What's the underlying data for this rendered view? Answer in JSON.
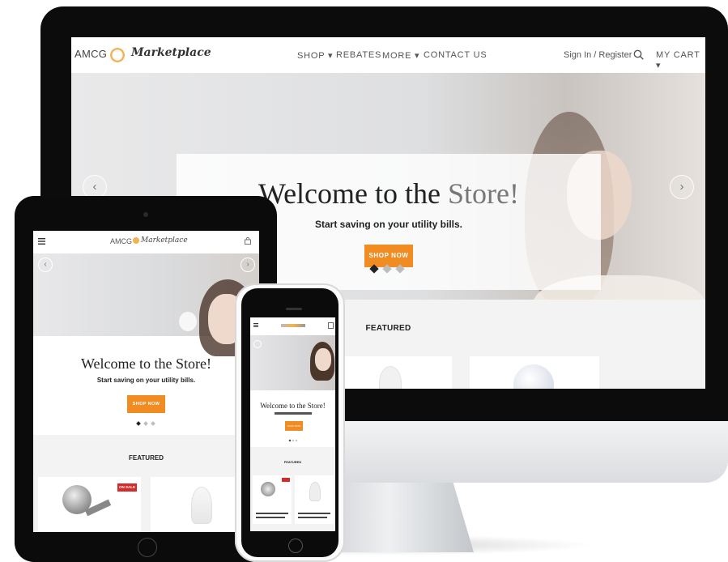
{
  "desktop": {
    "logo": {
      "prefix": "AMCG",
      "script": "Marketplace"
    },
    "nav": {
      "shop": "SHOP ▾",
      "rebates": "REBATES",
      "more": "MORE ▾",
      "contact": "CONTACT US"
    },
    "account": {
      "signin": "Sign In / Register",
      "cart": "MY CART ▾"
    },
    "hero": {
      "title_main": "Welcome to the ",
      "title_accent": "Store!",
      "subtitle": "Start saving on your utility bills.",
      "cta": "SHOP NOW"
    },
    "featured": "FEATURED"
  },
  "tablet": {
    "logo": {
      "prefix": "AMCG",
      "script": "Marketplace"
    },
    "hero": {
      "title": "Welcome to the Store!",
      "subtitle": "Start saving on your utility bills.",
      "cta": "SHOP NOW"
    },
    "featured": "FEATURED",
    "sale_badge": "ON SALE"
  },
  "phone": {
    "hero": {
      "title": "Welcome to the Store!",
      "cta": "SHOP NOW"
    },
    "featured": "FEATURED"
  },
  "icons": {
    "search": "search-icon",
    "menu": "hamburger-menu-icon",
    "bag": "shopping-bag-icon",
    "prev": "chevron-left-icon",
    "next": "chevron-right-icon"
  },
  "colors": {
    "accent": "#f08c22",
    "sale": "#d42a2a",
    "text": "#222222"
  }
}
